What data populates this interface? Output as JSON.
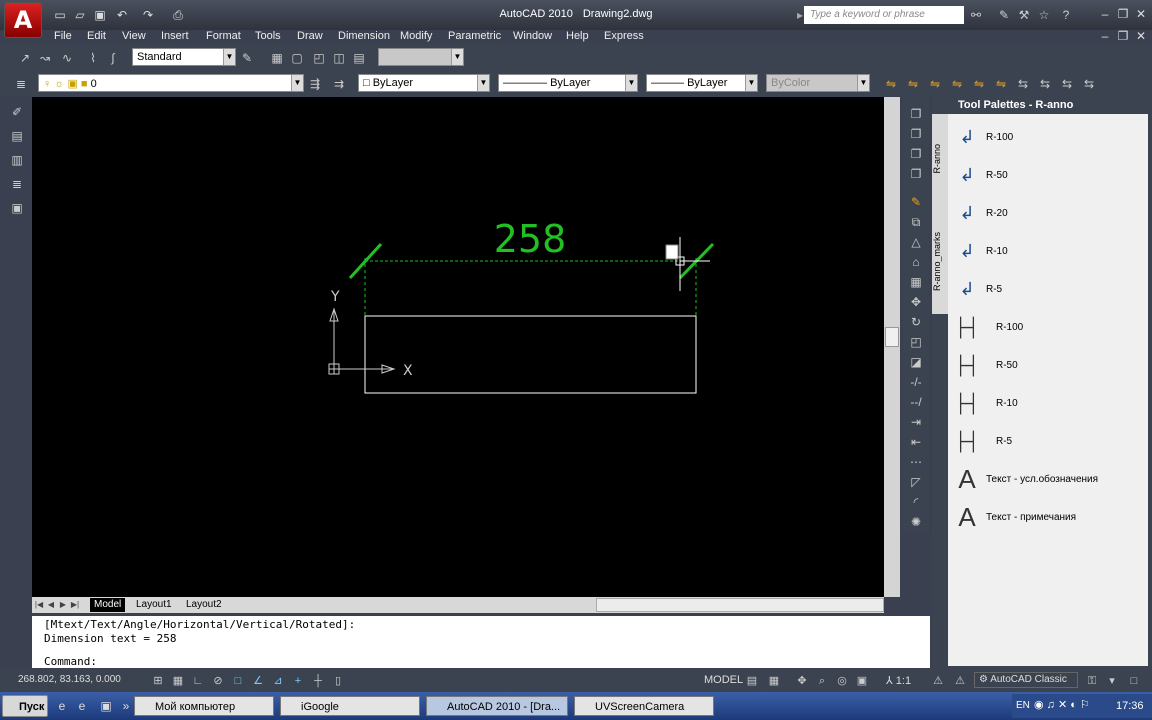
{
  "titlebar": {
    "app_name": "AutoCAD 2010",
    "doc_name": "Drawing2.dwg",
    "search_placeholder": "Type a keyword or phrase",
    "logo_letter": "A"
  },
  "menu": [
    "File",
    "Edit",
    "View",
    "Insert",
    "Format",
    "Tools",
    "Draw",
    "Dimension",
    "Modify",
    "Parametric",
    "Window",
    "Help",
    "Express"
  ],
  "toolbar1": {
    "text_style": "Standard"
  },
  "toolbar2": {
    "layer": "0",
    "color": "ByLayer",
    "linetype": "ByLayer",
    "lineweight": "ByLayer",
    "plotstyle": "ByColor"
  },
  "canvas": {
    "dimension_value": "258",
    "ucs_x_label": "X",
    "ucs_y_label": "Y",
    "dimension_color": "#22c022"
  },
  "layout_tabs": [
    {
      "label": "Model",
      "active": true
    },
    {
      "label": "Layout1",
      "active": false
    },
    {
      "label": "Layout2",
      "active": false
    }
  ],
  "palette": {
    "title": "Tool Palettes - R-anno",
    "side_tabs": [
      "R-anno",
      "R-anno_marks"
    ],
    "items": [
      {
        "label": "R-100",
        "icon": "leader-icon"
      },
      {
        "label": "R-50",
        "icon": "leader-icon"
      },
      {
        "label": "R-20",
        "icon": "leader-icon"
      },
      {
        "label": "R-10",
        "icon": "leader-icon"
      },
      {
        "label": "R-5",
        "icon": "leader-icon"
      },
      {
        "label": "R-100",
        "icon": "dimension-icon"
      },
      {
        "label": "R-50",
        "icon": "dimension-icon"
      },
      {
        "label": "R-10",
        "icon": "dimension-icon"
      },
      {
        "label": "R-5",
        "icon": "dimension-icon"
      },
      {
        "label": "Текст - усл.обозначения",
        "icon": "text-icon"
      },
      {
        "label": "Текст - примечания",
        "icon": "text-icon"
      }
    ]
  },
  "command_line": {
    "line1": "[Mtext/Text/Angle/Horizontal/Vertical/Rotated]:",
    "line2": "Dimension text = 258",
    "prompt": "Command:"
  },
  "statusbar": {
    "coords": "268.802, 83.163, 0.000",
    "model_label": "MODEL",
    "scale": "1:1",
    "workspace": "AutoCAD Classic"
  },
  "taskbar": {
    "start": "Пуск",
    "tasks": [
      "Мой компьютер",
      "iGoogle",
      "AutoCAD 2010 - [Dra...",
      "UVScreenCamera"
    ],
    "lang": "EN",
    "time": "17:36"
  }
}
